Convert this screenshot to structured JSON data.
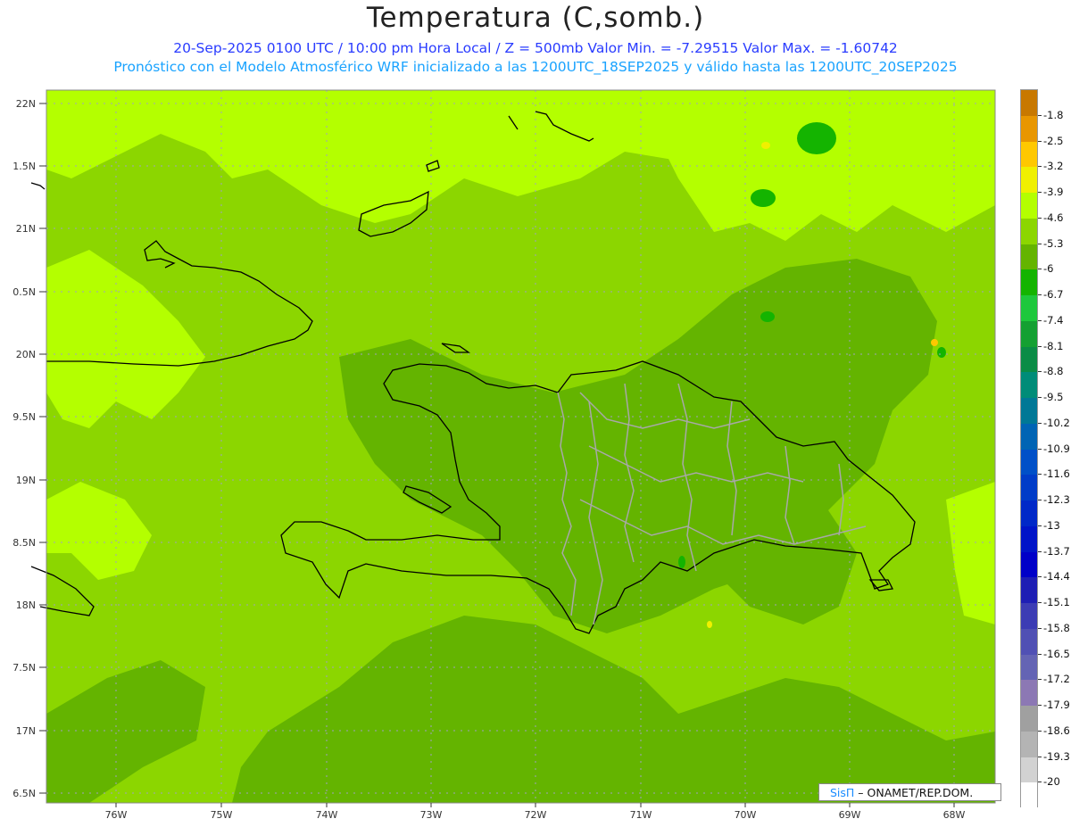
{
  "header": {
    "title": "Temperatura (C,somb.)",
    "subtitle1": "20-Sep-2025  0100 UTC / 10:00 pm Hora Local / Z = 500mb  Valor Min. = -7.29515  Valor Max. = -1.60742",
    "subtitle2": "Pronóstico con el Modelo Atmosférico WRF inicializado a las 1200UTC_18SEP2025 y válido hasta las  1200UTC_20SEP2025"
  },
  "map": {
    "lat_labels": [
      "22N",
      "1.5N",
      "21N",
      "0.5N",
      "20N",
      "9.5N",
      "19N",
      "8.5N",
      "18N",
      "7.5N",
      "17N",
      "6.5N"
    ],
    "lon_labels": [
      "76W",
      "75W",
      "74W",
      "73W",
      "72W",
      "71W",
      "70W",
      "69W",
      "68W"
    ],
    "background_color": "#8cd600"
  },
  "colorbar": {
    "labels": [
      "-1.8",
      "-2.5",
      "-3.2",
      "-3.9",
      "-4.6",
      "-5.3",
      "-6",
      "-6.7",
      "-7.4",
      "-8.1",
      "-8.8",
      "-9.5",
      "-10.2",
      "-10.9",
      "-11.6",
      "-12.3",
      "-13",
      "-13.7",
      "-14.4",
      "-15.1",
      "-15.8",
      "-16.5",
      "-17.2",
      "-17.9",
      "-18.6",
      "-19.3",
      "-20"
    ],
    "colors": [
      "#c87800",
      "#e89600",
      "#ffc800",
      "#f0f000",
      "#b4ff00",
      "#8cd600",
      "#64b400",
      "#14b400",
      "#1ec83c",
      "#14a032",
      "#0a8c46",
      "#008c78",
      "#007896",
      "#0064b4",
      "#0050c8",
      "#003cc8",
      "#0028c8",
      "#0014c8",
      "#0000c8",
      "#1e1eb4",
      "#3c3cb4",
      "#5050b4",
      "#6464b4",
      "#8c78b4",
      "#a0a0a0",
      "#b4b4b4",
      "#d2d2d2",
      "#ffffff"
    ]
  },
  "credit": {
    "brand": "SisΠ",
    "org": " – ONAMET/REP.DOM."
  }
}
